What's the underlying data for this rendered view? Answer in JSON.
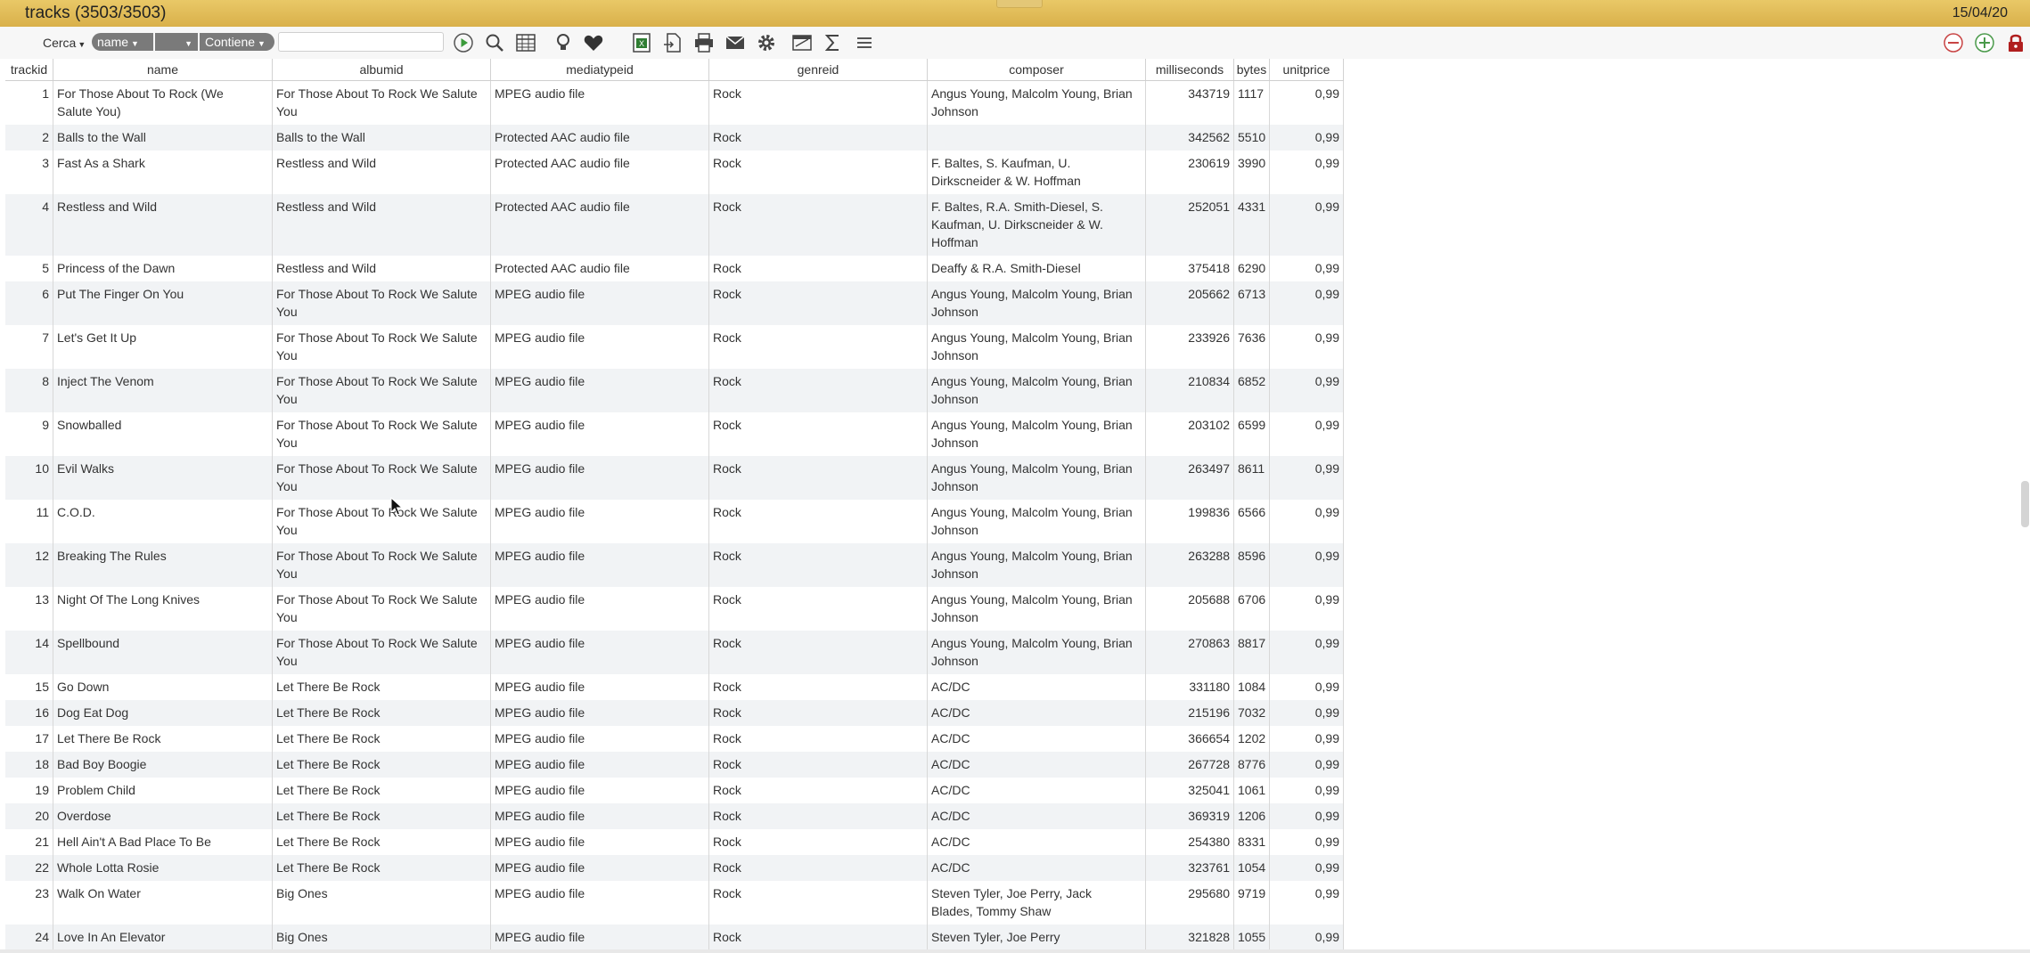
{
  "window": {
    "title": "tracks (3503/3503)",
    "date": "15/04/20"
  },
  "toolbar": {
    "search_label": "Cerca",
    "field_value": "name",
    "middle_value": "",
    "operator_value": "Contiene",
    "search_value": ""
  },
  "columns": [
    "trackid",
    "name",
    "albumid",
    "mediatypeid",
    "genreid",
    "composer",
    "milliseconds",
    "bytes",
    "unitprice"
  ],
  "rows": [
    {
      "id": "1",
      "name": [
        "For Those About To Rock (We",
        "Salute You)"
      ],
      "album": [
        "For Those About To Rock We Salute",
        "You"
      ],
      "media": "MPEG audio file",
      "genre": "Rock",
      "composer": [
        "Angus Young, Malcolm Young, Brian",
        "Johnson"
      ],
      "ms": "343719",
      "bytes": "1117",
      "price": "0,99"
    },
    {
      "id": "2",
      "name": [
        "Balls to the Wall"
      ],
      "album": [
        "Balls to the Wall"
      ],
      "media": "Protected AAC audio file",
      "genre": "Rock",
      "composer": [
        ""
      ],
      "ms": "342562",
      "bytes": "5510",
      "price": "0,99"
    },
    {
      "id": "3",
      "name": [
        "Fast As a Shark"
      ],
      "album": [
        "Restless and Wild"
      ],
      "media": "Protected AAC audio file",
      "genre": "Rock",
      "composer": [
        "F. Baltes, S. Kaufman, U.",
        "Dirkscneider & W. Hoffman"
      ],
      "ms": "230619",
      "bytes": "3990",
      "price": "0,99"
    },
    {
      "id": "4",
      "name": [
        "Restless and Wild"
      ],
      "album": [
        "Restless and Wild"
      ],
      "media": "Protected AAC audio file",
      "genre": "Rock",
      "composer": [
        "F. Baltes, R.A. Smith-Diesel, S.",
        "Kaufman, U. Dirkscneider & W.",
        "Hoffman"
      ],
      "ms": "252051",
      "bytes": "4331",
      "price": "0,99"
    },
    {
      "id": "5",
      "name": [
        "Princess of the Dawn"
      ],
      "album": [
        "Restless and Wild"
      ],
      "media": "Protected AAC audio file",
      "genre": "Rock",
      "composer": [
        "Deaffy & R.A. Smith-Diesel"
      ],
      "ms": "375418",
      "bytes": "6290",
      "price": "0,99"
    },
    {
      "id": "6",
      "name": [
        "Put The Finger On You"
      ],
      "album": [
        "For Those About To Rock We Salute",
        "You"
      ],
      "media": "MPEG audio file",
      "genre": "Rock",
      "composer": [
        "Angus Young, Malcolm Young, Brian",
        "Johnson"
      ],
      "ms": "205662",
      "bytes": "6713",
      "price": "0,99"
    },
    {
      "id": "7",
      "name": [
        "Let's Get It Up"
      ],
      "album": [
        "For Those About To Rock We Salute",
        "You"
      ],
      "media": "MPEG audio file",
      "genre": "Rock",
      "composer": [
        "Angus Young, Malcolm Young, Brian",
        "Johnson"
      ],
      "ms": "233926",
      "bytes": "7636",
      "price": "0,99"
    },
    {
      "id": "8",
      "name": [
        "Inject The Venom"
      ],
      "album": [
        "For Those About To Rock We Salute",
        "You"
      ],
      "media": "MPEG audio file",
      "genre": "Rock",
      "composer": [
        "Angus Young, Malcolm Young, Brian",
        "Johnson"
      ],
      "ms": "210834",
      "bytes": "6852",
      "price": "0,99"
    },
    {
      "id": "9",
      "name": [
        "Snowballed"
      ],
      "album": [
        "For Those About To Rock We Salute",
        "You"
      ],
      "media": "MPEG audio file",
      "genre": "Rock",
      "composer": [
        "Angus Young, Malcolm Young, Brian",
        "Johnson"
      ],
      "ms": "203102",
      "bytes": "6599",
      "price": "0,99"
    },
    {
      "id": "10",
      "name": [
        "Evil Walks"
      ],
      "album": [
        "For Those About To Rock We Salute",
        "You"
      ],
      "media": "MPEG audio file",
      "genre": "Rock",
      "composer": [
        "Angus Young, Malcolm Young, Brian",
        "Johnson"
      ],
      "ms": "263497",
      "bytes": "8611",
      "price": "0,99"
    },
    {
      "id": "11",
      "name": [
        "C.O.D."
      ],
      "album": [
        "For Those About To Rock We Salute",
        "You"
      ],
      "media": "MPEG audio file",
      "genre": "Rock",
      "composer": [
        "Angus Young, Malcolm Young, Brian",
        "Johnson"
      ],
      "ms": "199836",
      "bytes": "6566",
      "price": "0,99"
    },
    {
      "id": "12",
      "name": [
        "Breaking The Rules"
      ],
      "album": [
        "For Those About To Rock We Salute",
        "You"
      ],
      "media": "MPEG audio file",
      "genre": "Rock",
      "composer": [
        "Angus Young, Malcolm Young, Brian",
        "Johnson"
      ],
      "ms": "263288",
      "bytes": "8596",
      "price": "0,99"
    },
    {
      "id": "13",
      "name": [
        "Night Of The Long Knives"
      ],
      "album": [
        "For Those About To Rock We Salute",
        "You"
      ],
      "media": "MPEG audio file",
      "genre": "Rock",
      "composer": [
        "Angus Young, Malcolm Young, Brian",
        "Johnson"
      ],
      "ms": "205688",
      "bytes": "6706",
      "price": "0,99"
    },
    {
      "id": "14",
      "name": [
        "Spellbound"
      ],
      "album": [
        "For Those About To Rock We Salute",
        "You"
      ],
      "media": "MPEG audio file",
      "genre": "Rock",
      "composer": [
        "Angus Young, Malcolm Young, Brian",
        "Johnson"
      ],
      "ms": "270863",
      "bytes": "8817",
      "price": "0,99"
    },
    {
      "id": "15",
      "name": [
        "Go Down"
      ],
      "album": [
        "Let There Be Rock"
      ],
      "media": "MPEG audio file",
      "genre": "Rock",
      "composer": [
        "AC/DC"
      ],
      "ms": "331180",
      "bytes": "1084",
      "price": "0,99"
    },
    {
      "id": "16",
      "name": [
        "Dog Eat Dog"
      ],
      "album": [
        "Let There Be Rock"
      ],
      "media": "MPEG audio file",
      "genre": "Rock",
      "composer": [
        "AC/DC"
      ],
      "ms": "215196",
      "bytes": "7032",
      "price": "0,99"
    },
    {
      "id": "17",
      "name": [
        "Let There Be Rock"
      ],
      "album": [
        "Let There Be Rock"
      ],
      "media": "MPEG audio file",
      "genre": "Rock",
      "composer": [
        "AC/DC"
      ],
      "ms": "366654",
      "bytes": "1202",
      "price": "0,99"
    },
    {
      "id": "18",
      "name": [
        "Bad Boy Boogie"
      ],
      "album": [
        "Let There Be Rock"
      ],
      "media": "MPEG audio file",
      "genre": "Rock",
      "composer": [
        "AC/DC"
      ],
      "ms": "267728",
      "bytes": "8776",
      "price": "0,99"
    },
    {
      "id": "19",
      "name": [
        "Problem Child"
      ],
      "album": [
        "Let There Be Rock"
      ],
      "media": "MPEG audio file",
      "genre": "Rock",
      "composer": [
        "AC/DC"
      ],
      "ms": "325041",
      "bytes": "1061",
      "price": "0,99"
    },
    {
      "id": "20",
      "name": [
        "Overdose"
      ],
      "album": [
        "Let There Be Rock"
      ],
      "media": "MPEG audio file",
      "genre": "Rock",
      "composer": [
        "AC/DC"
      ],
      "ms": "369319",
      "bytes": "1206",
      "price": "0,99"
    },
    {
      "id": "21",
      "name": [
        "Hell Ain't A Bad Place To Be"
      ],
      "album": [
        "Let There Be Rock"
      ],
      "media": "MPEG audio file",
      "genre": "Rock",
      "composer": [
        "AC/DC"
      ],
      "ms": "254380",
      "bytes": "8331",
      "price": "0,99"
    },
    {
      "id": "22",
      "name": [
        "Whole Lotta Rosie"
      ],
      "album": [
        "Let There Be Rock"
      ],
      "media": "MPEG audio file",
      "genre": "Rock",
      "composer": [
        "AC/DC"
      ],
      "ms": "323761",
      "bytes": "1054",
      "price": "0,99"
    },
    {
      "id": "23",
      "name": [
        "Walk On Water"
      ],
      "album": [
        "Big Ones"
      ],
      "media": "MPEG audio file",
      "genre": "Rock",
      "composer": [
        "Steven Tyler, Joe Perry, Jack",
        "Blades, Tommy Shaw"
      ],
      "ms": "295680",
      "bytes": "9719",
      "price": "0,99"
    },
    {
      "id": "24",
      "name": [
        "Love In An Elevator"
      ],
      "album": [
        "Big Ones"
      ],
      "media": "MPEG audio file",
      "genre": "Rock",
      "composer": [
        "Steven Tyler, Joe Perry"
      ],
      "ms": "321828",
      "bytes": "1055",
      "price": "0,99"
    }
  ]
}
